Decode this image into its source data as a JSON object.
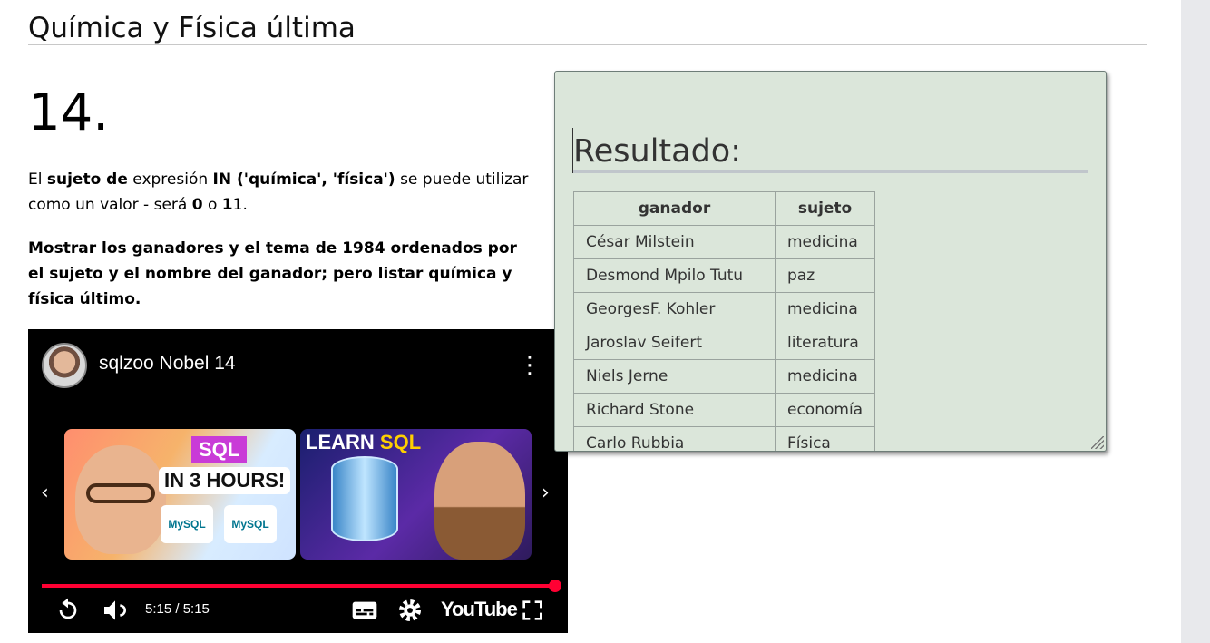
{
  "section": {
    "title": "Química y Física última"
  },
  "question": {
    "number": "14.",
    "p1": [
      {
        "text": "El ",
        "bold": false
      },
      {
        "text": "sujeto de",
        "bold": true
      },
      {
        "text": " expresión ",
        "bold": false
      },
      {
        "text": "IN ('química', 'física')",
        "bold": true
      },
      {
        "text": " se puede utilizar como un valor - será ",
        "bold": false
      },
      {
        "text": "0",
        "bold": true
      },
      {
        "text": " o ",
        "bold": false
      },
      {
        "text": "1",
        "bold": true
      },
      {
        "text": "1.",
        "bold": false
      }
    ],
    "p2": "Mostrar los ganadores y el tema de 1984 ordenados por el sujeto y el nombre del ganador; pero listar química y física último."
  },
  "video": {
    "title": "sqlzoo Nobel 14",
    "time": "5:15 / 5:15",
    "progress_fraction": 1.0,
    "brand": "YouTube",
    "thumb1": {
      "sql": "SQL",
      "hours": "IN 3 HOURS!",
      "logo": "MySQL"
    },
    "thumb2": {
      "learn": "LEARN",
      "sql": "SQL"
    },
    "icons": [
      "replay-icon",
      "volume-icon",
      "subtitles-icon",
      "settings-icon",
      "fullscreen-icon",
      "more-vert-icon",
      "chevron-left-icon",
      "chevron-right-icon"
    ]
  },
  "result": {
    "title": "Resultado:",
    "columns": [
      "ganador",
      "sujeto"
    ],
    "rows": [
      [
        "César Milstein",
        "medicina"
      ],
      [
        "Desmond Mpilo Tutu",
        "paz"
      ],
      [
        "GeorgesF. Kohler",
        "medicina"
      ],
      [
        "Jaroslav Seifert",
        "literatura"
      ],
      [
        "Niels Jerne",
        "medicina"
      ],
      [
        "Richard Stone",
        "economía"
      ],
      [
        "Carlo Rubbia",
        "Física"
      ]
    ]
  },
  "colors": {
    "panel_bg": "#dbe6da",
    "progress": "#ff0033"
  }
}
